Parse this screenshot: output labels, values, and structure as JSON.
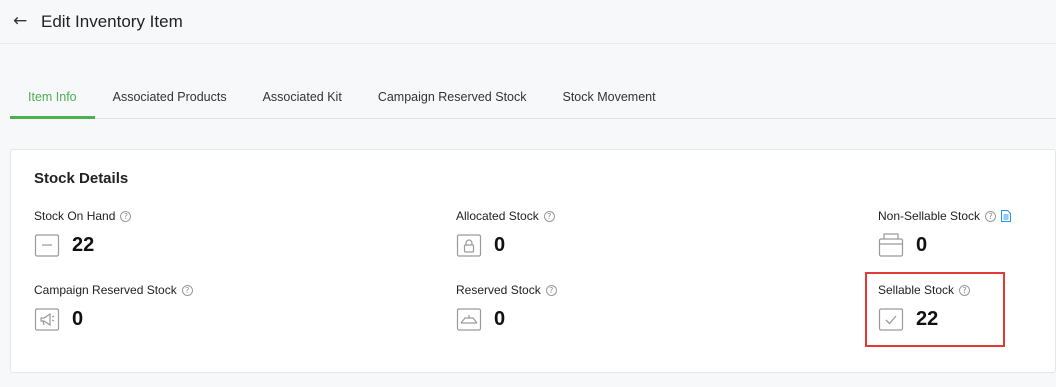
{
  "header": {
    "back_icon": "arrow-left-icon",
    "title": "Edit Inventory Item"
  },
  "tabs": [
    {
      "label": "Item Info",
      "active": true
    },
    {
      "label": "Associated Products",
      "active": false
    },
    {
      "label": "Associated Kit",
      "active": false
    },
    {
      "label": "Campaign Reserved Stock",
      "active": false
    },
    {
      "label": "Stock Movement",
      "active": false
    }
  ],
  "stock_details": {
    "title": "Stock Details",
    "stock_on_hand": {
      "label": "Stock On Hand",
      "value": "22",
      "icon": "box-icon"
    },
    "allocated_stock": {
      "label": "Allocated Stock",
      "value": "0",
      "icon": "locked-box-icon"
    },
    "non_sellable_stock": {
      "label": "Non-Sellable Stock",
      "value": "0",
      "icon": "open-box-icon",
      "extra_icon": "document-icon"
    },
    "campaign_reserved_stock": {
      "label": "Campaign Reserved Stock",
      "value": "0",
      "icon": "megaphone-icon"
    },
    "reserved_stock": {
      "label": "Reserved Stock",
      "value": "0",
      "icon": "reserved-box-icon"
    },
    "sellable_stock": {
      "label": "Sellable Stock",
      "value": "22",
      "icon": "checked-box-icon",
      "highlighted": true
    }
  },
  "colors": {
    "accent": "#4caf50",
    "highlight": "#e53935",
    "help_icon": "#9a9a9a",
    "doc_icon": "#2196f3"
  }
}
